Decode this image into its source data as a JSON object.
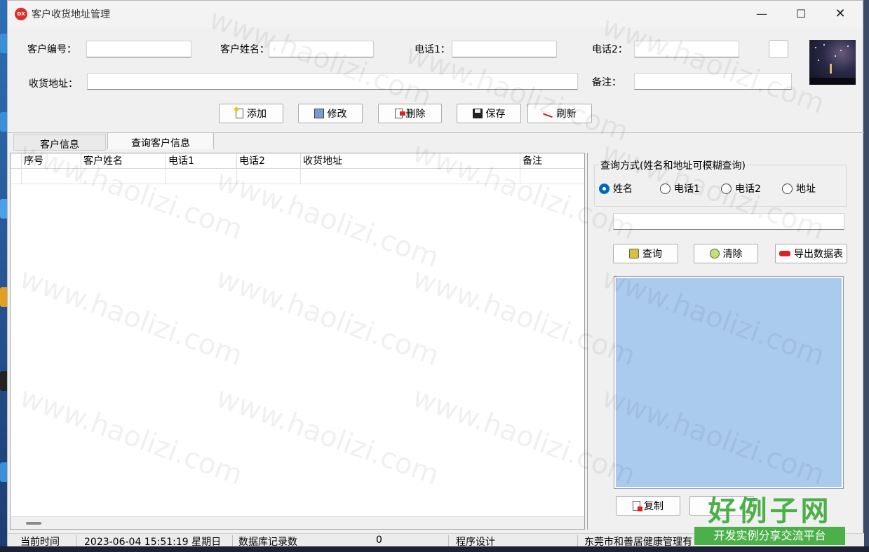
{
  "window": {
    "title": "客户收货地址管理",
    "app_icon_text": "DX"
  },
  "form": {
    "customer_no_label": "客户编号：",
    "customer_no_value": "",
    "customer_name_label": "客户姓名：",
    "customer_name_value": "",
    "phone1_label": "电话1：",
    "phone1_value": "",
    "phone2_label": "电话2：",
    "phone2_value": "",
    "address_label": "收货地址：",
    "address_value": "",
    "remark_label": "备注：",
    "remark_value": ""
  },
  "toolbar": {
    "add_label": "添加",
    "edit_label": "修改",
    "delete_label": "删除",
    "save_label": "保存",
    "refresh_label": "刷新"
  },
  "tabs": [
    {
      "label": "客户信息"
    },
    {
      "label": "查询客户信息"
    }
  ],
  "grid": {
    "columns": [
      "序号",
      "客户姓名",
      "电话1",
      "电话2",
      "收货地址",
      "备注"
    ]
  },
  "query": {
    "group_title": "查询方式(姓名和地址可模糊查询)",
    "options": [
      "姓名",
      "电话1",
      "电话2",
      "地址"
    ],
    "selected": "姓名",
    "search_value": "",
    "query_label": "查询",
    "clear_label": "清除",
    "export_label": "导出数据表",
    "copy_label": "复制"
  },
  "status": {
    "time_label": "当前时间",
    "time_value": "2023-06-04 15:51:19 星期日",
    "count_label": "数据库记录数",
    "count_value": "0",
    "designer_label": "程序设计",
    "company": "东莞市和善居健康管理有"
  },
  "watermark_text": "www.haolizi.com",
  "brand": {
    "title": "好例子网",
    "subtitle": "开发实例分享交流平台"
  }
}
